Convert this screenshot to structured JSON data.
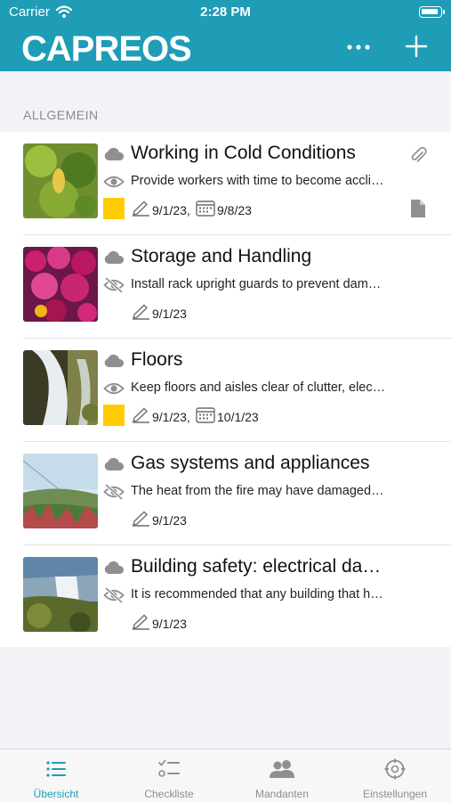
{
  "status_bar": {
    "carrier": "Carrier",
    "time": "2:28 PM"
  },
  "nav": {
    "logo": "CAPREOS",
    "more_icon": "ellipsis-icon",
    "add_icon": "plus-icon"
  },
  "section": {
    "title": "ALLGEMEIN"
  },
  "items": [
    {
      "title": "Working in Cold Conditions",
      "description": "Provide workers with time to become accli…",
      "edited": "9/1/23,",
      "due": "9/8/23",
      "has_attachment": true,
      "has_document": true,
      "tag_color": "#ffcc00",
      "visibility": "visible"
    },
    {
      "title": "Storage and Handling",
      "description": "Install rack upright guards to prevent dam…",
      "edited": "9/1/23",
      "visibility": "hidden"
    },
    {
      "title": "Floors",
      "description": "Keep floors and aisles clear of clutter, elec…",
      "edited": "9/1/23,",
      "due": "10/1/23",
      "tag_color": "#ffcc00",
      "visibility": "visible"
    },
    {
      "title": "Gas systems and appliances",
      "description": "The heat from the fire may have damaged…",
      "edited": "9/1/23",
      "visibility": "hidden"
    },
    {
      "title": "Building safety: electrical da…",
      "description": "It is recommended that any building that h…",
      "edited": "9/1/23",
      "visibility": "hidden"
    }
  ],
  "tabs": [
    {
      "label": "Übersicht",
      "icon": "list-icon",
      "active": true
    },
    {
      "label": "Checkliste",
      "icon": "checklist-icon",
      "active": false
    },
    {
      "label": "Mandanten",
      "icon": "users-icon",
      "active": false
    },
    {
      "label": "Einstellungen",
      "icon": "gear-icon",
      "active": false
    }
  ],
  "colors": {
    "brand": "#1f9cb6",
    "tag_yellow": "#ffcc00",
    "icon_gray": "#8e8e93"
  }
}
